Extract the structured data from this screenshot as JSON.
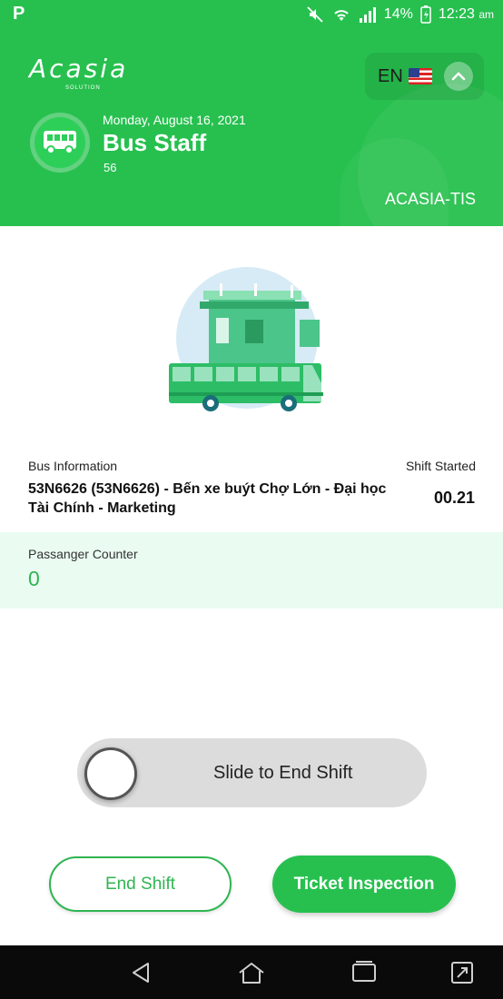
{
  "status_bar": {
    "app_icon": "P",
    "battery": "14%",
    "time": "12:23",
    "ampm": "am",
    "icons": [
      "mute-icon",
      "wifi-icon",
      "signal-icon",
      "battery-charging-icon"
    ]
  },
  "header": {
    "logo": "Acasia",
    "logo_sub": "SOLUTION",
    "language": "EN",
    "flag_icon": "us-flag-icon",
    "date": "Monday, August 16, 2021",
    "role": "Bus Staff",
    "staff_id": "56",
    "company": "ACASIA-TIS"
  },
  "bus_info": {
    "label": "Bus Information",
    "value": "53N6626 (53N6626) - Bến xe buýt Chợ Lớn - Đại học Tài Chính - Marketing",
    "shift_label": "Shift Started",
    "shift_value": "00.21"
  },
  "counter": {
    "label": "Passanger Counter",
    "value": "0"
  },
  "slider": {
    "label": "Slide to End Shift"
  },
  "buttons": {
    "end_shift": "End Shift",
    "ticket_inspection": "Ticket Inspection"
  },
  "colors": {
    "primary": "#27c04f",
    "accent_text": "#2fb552",
    "counter_bg": "#eafbf1"
  }
}
